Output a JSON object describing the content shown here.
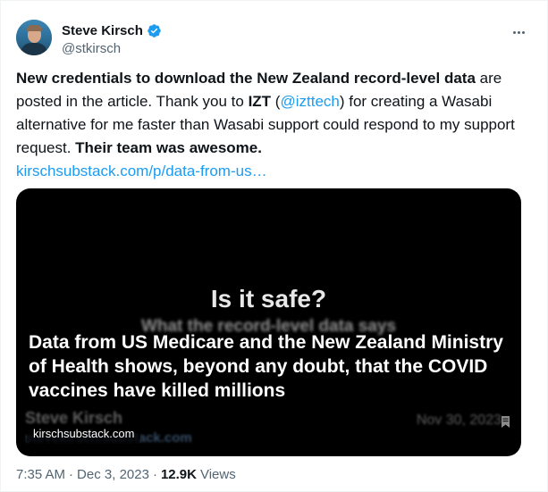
{
  "author": {
    "display_name": "Steve Kirsch",
    "handle": "@stkirsch",
    "verified_icon": "verified-badge-icon",
    "more_icon": "more-options-icon"
  },
  "tweet": {
    "segments": {
      "s1_bold": "New credentials to download the New Zealand record-level data",
      "s2": " are posted in the article. Thank you to ",
      "s3_bold": "IZT",
      "s4": " (",
      "s5_mention": "@izttech",
      "s6": ") for creating a Wasabi alternative for me faster than Wasabi support could respond to my support request. ",
      "s7_bold": "Their team was awesome."
    },
    "link": "kirschsubstack.com/p/data-from-us…"
  },
  "media_card": {
    "title": "Is it safe?",
    "subtitle": "What the record-level data says",
    "overlay_text": "Data from US Medicare and the New Zealand Ministry of Health shows, beyond any doubt, that the COVID vaccines have killed millions",
    "author": "Steve Kirsch",
    "author_url": "stevekirsch.substack.com",
    "date": "Nov 30, 2023",
    "domain": "kirschsubstack.com",
    "bookmark_icon": "bookmark-icon"
  },
  "meta": {
    "time": "7:35 AM",
    "date": "Dec 3, 2023",
    "views_count": "12.9K",
    "views_label": "Views"
  },
  "colors": {
    "accent": "#1d9bf0",
    "text": "#0f1419",
    "secondary": "#536471",
    "card_bg": "#000000"
  }
}
